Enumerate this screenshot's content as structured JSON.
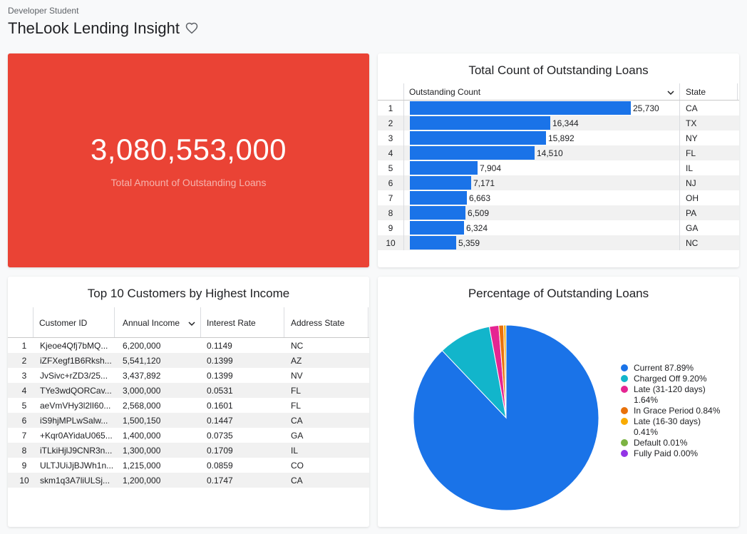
{
  "header": {
    "breadcrumb": "Developer Student",
    "title": "TheLook Lending Insight"
  },
  "kpi": {
    "value": "3,080,553,000",
    "label": "Total Amount of Outstanding Loans",
    "color": "#ea4335"
  },
  "loans_by_state": {
    "title": "Total Count of Outstanding Loans",
    "col_count": "Outstanding Count",
    "col_state": "State",
    "bar_color": "#1a73e8",
    "rows": [
      {
        "n": "1",
        "count": 25730,
        "label": "25,730",
        "state": "CA"
      },
      {
        "n": "2",
        "count": 16344,
        "label": "16,344",
        "state": "TX"
      },
      {
        "n": "3",
        "count": 15892,
        "label": "15,892",
        "state": "NY"
      },
      {
        "n": "4",
        "count": 14510,
        "label": "14,510",
        "state": "FL"
      },
      {
        "n": "5",
        "count": 7904,
        "label": "7,904",
        "state": "IL"
      },
      {
        "n": "6",
        "count": 7171,
        "label": "7,171",
        "state": "NJ"
      },
      {
        "n": "7",
        "count": 6663,
        "label": "6,663",
        "state": "OH"
      },
      {
        "n": "8",
        "count": 6509,
        "label": "6,509",
        "state": "PA"
      },
      {
        "n": "9",
        "count": 6324,
        "label": "6,324",
        "state": "GA"
      },
      {
        "n": "10",
        "count": 5359,
        "label": "5,359",
        "state": "NC"
      }
    ]
  },
  "customers": {
    "title": "Top 10 Customers by Highest Income",
    "columns": [
      "Customer ID",
      "Annual Income",
      "Interest Rate",
      "Address State"
    ],
    "rows": [
      {
        "n": "1",
        "id": "Kjeoe4Qfj7bMQ...",
        "income": "6,200,000",
        "rate": "0.1149",
        "state": "NC"
      },
      {
        "n": "2",
        "id": "iZFXegf1B6Rksh...",
        "income": "5,541,120",
        "rate": "0.1399",
        "state": "AZ"
      },
      {
        "n": "3",
        "id": "JvSivc+rZD3/25...",
        "income": "3,437,892",
        "rate": "0.1399",
        "state": "NV"
      },
      {
        "n": "4",
        "id": "TYe3wdQORCav...",
        "income": "3,000,000",
        "rate": "0.0531",
        "state": "FL"
      },
      {
        "n": "5",
        "id": "aeVmVHy3l2lI60...",
        "income": "2,568,000",
        "rate": "0.1601",
        "state": "FL"
      },
      {
        "n": "6",
        "id": "iS9hjMPLwSalw...",
        "income": "1,500,150",
        "rate": "0.1447",
        "state": "CA"
      },
      {
        "n": "7",
        "id": "+Kqr0AYidaU065...",
        "income": "1,400,000",
        "rate": "0.0735",
        "state": "GA"
      },
      {
        "n": "8",
        "id": "iTLkiHjlJ9CNR3n...",
        "income": "1,300,000",
        "rate": "0.1709",
        "state": "IL"
      },
      {
        "n": "9",
        "id": "ULTJUiJjBJWh1n...",
        "income": "1,215,000",
        "rate": "0.0859",
        "state": "CO"
      },
      {
        "n": "10",
        "id": "skm1q3A7liULSj...",
        "income": "1,200,000",
        "rate": "0.1747",
        "state": "CA"
      }
    ]
  },
  "chart_data": {
    "type": "pie",
    "title": "Percentage of Outstanding Loans",
    "legend_position": "right",
    "slices": [
      {
        "name": "Current",
        "value": 87.89,
        "label": "Current 87.89%",
        "color": "#1a73e8"
      },
      {
        "name": "Charged Off",
        "value": 9.2,
        "label": "Charged Off 9.20%",
        "color": "#12b5cb"
      },
      {
        "name": "Late (31-120 days)",
        "value": 1.64,
        "label": "Late (31-120 days) 1.64%",
        "color": "#e52592"
      },
      {
        "name": "In Grace Period",
        "value": 0.84,
        "label": "In Grace Period 0.84%",
        "color": "#e8710a"
      },
      {
        "name": "Late (16-30 days)",
        "value": 0.41,
        "label": "Late (16-30 days) 0.41%",
        "color": "#f9ab00"
      },
      {
        "name": "Default",
        "value": 0.01,
        "label": "Default 0.01%",
        "color": "#7cb342"
      },
      {
        "name": "Fully Paid",
        "value": 0.0,
        "label": "Fully Paid 0.00%",
        "color": "#9334e6"
      }
    ]
  }
}
